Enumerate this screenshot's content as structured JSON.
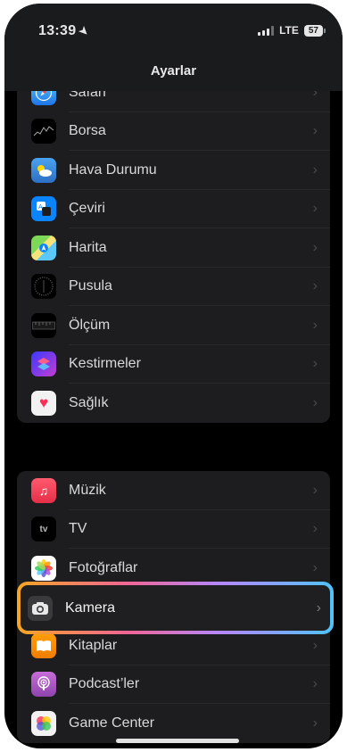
{
  "status": {
    "time": "13:39",
    "network": "LTE",
    "battery": "57"
  },
  "header": {
    "title": "Ayarlar"
  },
  "group1": [
    {
      "label": "Safari",
      "icon": "safari-icon"
    },
    {
      "label": "Borsa",
      "icon": "stocks-icon"
    },
    {
      "label": "Hava Durumu",
      "icon": "weather-icon"
    },
    {
      "label": "Çeviri",
      "icon": "translate-icon"
    },
    {
      "label": "Harita",
      "icon": "maps-icon"
    },
    {
      "label": "Pusula",
      "icon": "compass-icon"
    },
    {
      "label": "Ölçüm",
      "icon": "measure-icon"
    },
    {
      "label": "Kestirmeler",
      "icon": "shortcuts-icon"
    },
    {
      "label": "Sağlık",
      "icon": "health-icon"
    }
  ],
  "group2": [
    {
      "label": "Müzik",
      "icon": "music-icon"
    },
    {
      "label": "TV",
      "icon": "tv-icon"
    },
    {
      "label": "Fotoğraflar",
      "icon": "photos-icon"
    },
    {
      "label": "Kamera",
      "icon": "camera-icon"
    },
    {
      "label": "Kitaplar",
      "icon": "books-icon"
    },
    {
      "label": "Podcast’ler",
      "icon": "podcasts-icon"
    },
    {
      "label": "Game Center",
      "icon": "game-center-icon"
    }
  ],
  "highlighted": "Kamera"
}
